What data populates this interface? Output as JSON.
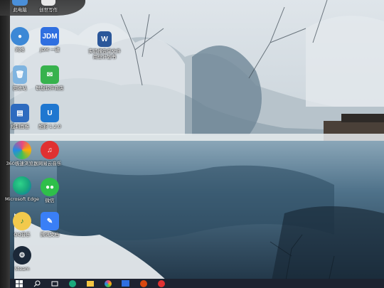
{
  "desktop": {
    "icons": [
      {
        "id": "this-pc",
        "label": "此电脑",
        "color": "#4a8fd9"
      },
      {
        "id": "create-write",
        "label": "创世写作",
        "color": "#e8e8e8"
      },
      {
        "id": "network",
        "label": "网络",
        "color": "#3c88d6"
      },
      {
        "id": "jdm",
        "label": "JDM 一键",
        "color": "#2f6fe0",
        "text": "JDM"
      },
      {
        "id": "word-doc",
        "label": "实验报告单文件 商业计划书",
        "color": "#2b579a",
        "text": "W"
      },
      {
        "id": "recycle-bin",
        "label": "回收站",
        "color": "#7fb4e0"
      },
      {
        "id": "lenovo-store",
        "label": "联想软件商店",
        "color": "#37b24d"
      },
      {
        "id": "control-panel",
        "label": "控制面板",
        "color": "#2d6bbf"
      },
      {
        "id": "kugou",
        "label": "酷狗 1.2.0",
        "color": "#1f77d0"
      },
      {
        "id": "browser-360",
        "label": "360极速浏览器",
        "color": "#e64980"
      },
      {
        "id": "netease-music",
        "label": "网易云音乐",
        "color": "#e03131"
      },
      {
        "id": "edge",
        "label": "Microsoft Edge",
        "color": "#1aa97c"
      },
      {
        "id": "wechat",
        "label": "微信",
        "color": "#2fbf4a"
      },
      {
        "id": "qq-music",
        "label": "QQ音乐",
        "color": "#f2c94c"
      },
      {
        "id": "feishu",
        "label": "腾讯文档",
        "color": "#3a7ff6"
      },
      {
        "id": "steam",
        "label": "Steam",
        "color": "#1b2838"
      }
    ]
  },
  "taskbar": {
    "items": [
      {
        "id": "start",
        "icon": "windows-start-icon"
      },
      {
        "id": "search",
        "icon": "search-icon"
      },
      {
        "id": "task-view",
        "icon": "task-view-icon"
      },
      {
        "id": "edge",
        "icon": "edge-icon"
      },
      {
        "id": "explorer",
        "icon": "folder-icon"
      },
      {
        "id": "browser360",
        "icon": "browser-360-icon"
      },
      {
        "id": "jdm",
        "icon": "jdm-icon"
      },
      {
        "id": "app2",
        "icon": "app-icon"
      },
      {
        "id": "netease",
        "icon": "netease-icon"
      }
    ]
  }
}
